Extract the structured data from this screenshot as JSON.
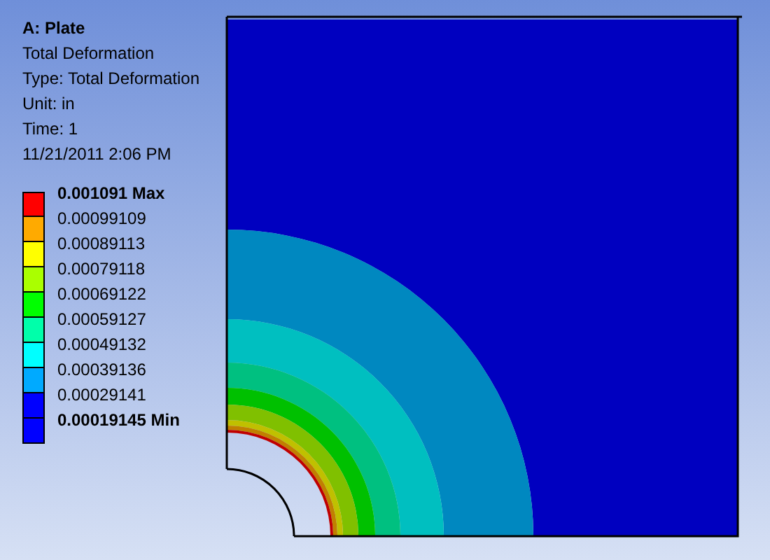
{
  "title": "A: Plate",
  "info_lines": [
    "Total Deformation",
    "Type: Total Deformation",
    "Unit: in",
    "Time: 1",
    "11/21/2011 2:06 PM"
  ],
  "legend": [
    {
      "label": "0.001091 Max",
      "color": "#ff0000",
      "kind": "max"
    },
    {
      "label": "0.00099109",
      "color": "#ffaa00",
      "kind": "level"
    },
    {
      "label": "0.00089113",
      "color": "#ffff00",
      "kind": "level"
    },
    {
      "label": "0.00079118",
      "color": "#aaff00",
      "kind": "level"
    },
    {
      "label": "0.00069122",
      "color": "#00ff00",
      "kind": "level"
    },
    {
      "label": "0.00059127",
      "color": "#00ffaa",
      "kind": "level"
    },
    {
      "label": "0.00049132",
      "color": "#00ffff",
      "kind": "level"
    },
    {
      "label": "0.00039136",
      "color": "#00aaff",
      "kind": "level"
    },
    {
      "label": "0.00029141",
      "color": "#0000ff",
      "kind": "level"
    },
    {
      "label": "0.00019145 Min",
      "color": "#0000ff",
      "kind": "min"
    }
  ]
}
